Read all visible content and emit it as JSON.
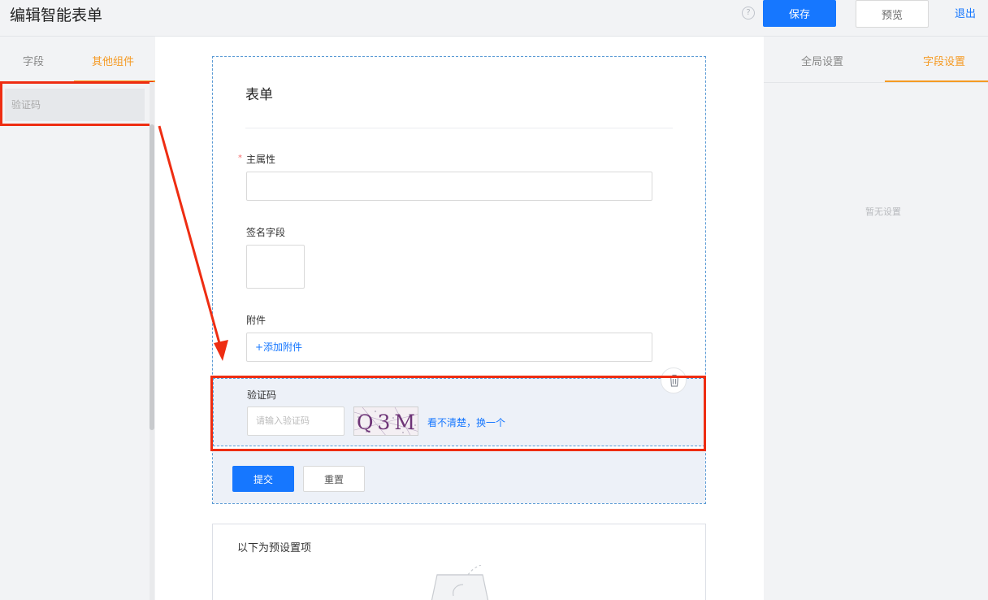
{
  "header": {
    "title": "编辑智能表单",
    "help_glyph": "?",
    "save_label": "保存",
    "preview_label": "预览",
    "exit_label": "退出"
  },
  "left_panel": {
    "tabs": [
      {
        "label": "字段",
        "active": false
      },
      {
        "label": "其他组件",
        "active": true
      }
    ],
    "components": [
      {
        "label": "验证码"
      }
    ]
  },
  "form": {
    "title": "表单",
    "fields": [
      {
        "label": "主属性",
        "required": true,
        "required_mark": "*",
        "type": "text",
        "value": ""
      },
      {
        "label": "签名字段",
        "required": false,
        "type": "signature"
      },
      {
        "label": "附件",
        "required": false,
        "type": "attachment",
        "action_label": "+添加附件"
      }
    ],
    "captcha": {
      "label": "验证码",
      "placeholder": "请输入验证码",
      "image_text": "Q3M",
      "refresh_label": "看不清楚，换一个"
    },
    "submit_label": "提交",
    "reset_label": "重置"
  },
  "preset": {
    "title": "以下为预设置项"
  },
  "right_panel": {
    "tabs": [
      {
        "label": "全局设置",
        "active": false
      },
      {
        "label": "字段设置",
        "active": true
      }
    ],
    "empty_text": "暂无设置"
  },
  "colors": {
    "primary": "#1677ff",
    "accent": "#f59a23",
    "annotation": "#ee2d12",
    "required": "#f56c6c"
  }
}
